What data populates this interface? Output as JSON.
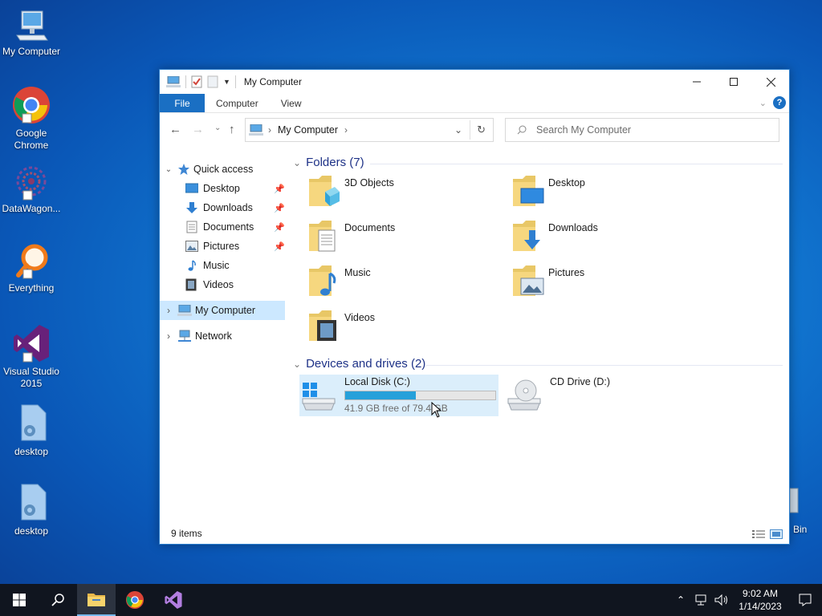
{
  "desktop": {
    "icons": [
      {
        "label": "My Computer"
      },
      {
        "label": "Google Chrome"
      },
      {
        "label": "DataWagon..."
      },
      {
        "label": "Everything"
      },
      {
        "label": "Visual Studio 2015"
      },
      {
        "label": "desktop"
      },
      {
        "label": "desktop"
      }
    ],
    "partial_label": "Bin"
  },
  "window": {
    "title": "My Computer",
    "tabs": {
      "file": "File",
      "computer": "Computer",
      "view": "View"
    },
    "help_glyph": "?",
    "address": {
      "segment": "My Computer",
      "sep": "›"
    },
    "search_placeholder": "Search My Computer",
    "nav": {
      "quick_access": "Quick access",
      "items": [
        {
          "label": "Desktop",
          "pinned": true
        },
        {
          "label": "Downloads",
          "pinned": true
        },
        {
          "label": "Documents",
          "pinned": true
        },
        {
          "label": "Pictures",
          "pinned": true
        },
        {
          "label": "Music",
          "pinned": false
        },
        {
          "label": "Videos",
          "pinned": false
        }
      ],
      "my_computer": "My Computer",
      "network": "Network"
    },
    "folders_header": "Folders (7)",
    "folders": [
      {
        "name": "3D Objects"
      },
      {
        "name": "Desktop"
      },
      {
        "name": "Documents"
      },
      {
        "name": "Downloads"
      },
      {
        "name": "Music"
      },
      {
        "name": "Pictures"
      },
      {
        "name": "Videos"
      }
    ],
    "devices_header": "Devices and drives (2)",
    "drives": [
      {
        "name": "Local Disk (C:)",
        "free_text": "41.9 GB free of 79.4 GB",
        "used_fraction": 0.47
      },
      {
        "name": "CD Drive (D:)"
      }
    ],
    "status": "9 items"
  },
  "taskbar": {
    "time": "9:02 AM",
    "date": "1/14/2023"
  },
  "colors": {
    "accent": "#1a6fc3",
    "selection": "#cce8ff",
    "group_header": "#1e3287",
    "progress": "#26a0da"
  }
}
